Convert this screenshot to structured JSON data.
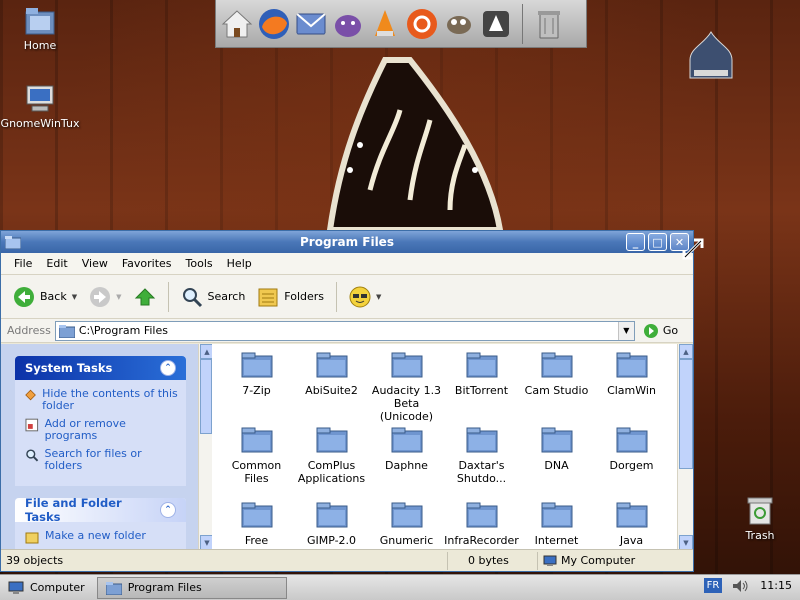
{
  "desktop": {
    "icons": [
      {
        "label": "Home"
      },
      {
        "label": "GnomeWinTux"
      },
      {
        "label": "Trash"
      }
    ]
  },
  "dock": {
    "apps": [
      "home-icon",
      "firefox-icon",
      "mail-icon",
      "pidgin-icon",
      "vlc-icon",
      "ubuntu-icon",
      "gimp-icon",
      "inkscape-icon",
      "trash-can-icon"
    ]
  },
  "window": {
    "title": "Program Files",
    "menu": [
      "File",
      "Edit",
      "View",
      "Favorites",
      "Tools",
      "Help"
    ],
    "toolbar": {
      "back": "Back",
      "search": "Search",
      "folders": "Folders"
    },
    "address": {
      "label": "Address",
      "value": "C:\\Program Files",
      "go": "Go"
    },
    "system_tasks": {
      "title": "System Tasks",
      "items": [
        "Hide the contents of this folder",
        "Add or remove programs",
        "Search for files or folders"
      ]
    },
    "file_tasks": {
      "title": "File and Folder Tasks",
      "items": [
        "Make a new folder"
      ]
    },
    "files": [
      [
        "7-Zip",
        "AbiSuite2",
        "Audacity 1.3 Beta (Unicode)",
        "BitTorrent",
        "Cam Studio",
        "ClamWin"
      ],
      [
        "Common Files",
        "ComPlus Applications",
        "Daphne",
        "Daxtar's Shutdo...",
        "DNA",
        "Dorgem"
      ],
      [
        "Free Download",
        "GIMP-2.0",
        "Gnumeric",
        "InfraRecorder",
        "Internet Explorer",
        "Java"
      ]
    ],
    "status": {
      "objects": "39 objects",
      "size": "0 bytes",
      "location": "My Computer"
    }
  },
  "taskbar": {
    "computer": "Computer",
    "active_window": "Program Files",
    "lang": "FR",
    "time": "11:15"
  }
}
